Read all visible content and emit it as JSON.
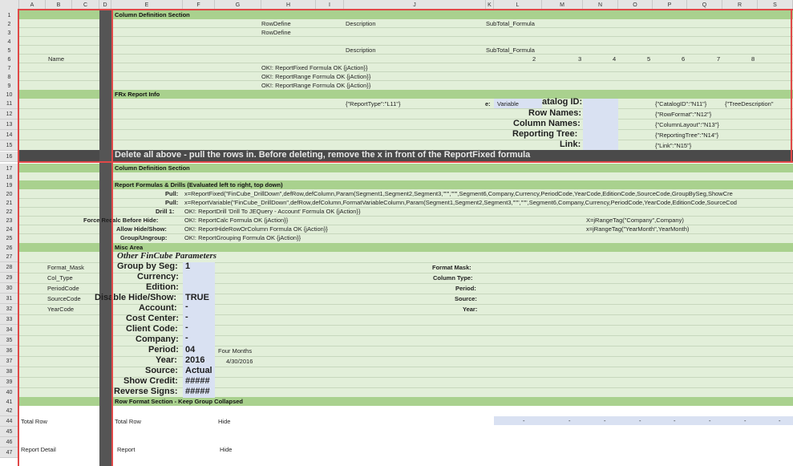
{
  "columns": [
    "A",
    "B",
    "C",
    "D",
    "E",
    "F",
    "G",
    "H",
    "I",
    "J",
    "K",
    "L",
    "M",
    "N",
    "O",
    "P",
    "Q",
    "R",
    "S"
  ],
  "rows": [
    "1",
    "2",
    "3",
    "4",
    "5",
    "6",
    "7",
    "8",
    "9",
    "10",
    "11",
    "12",
    "13",
    "14",
    "15",
    "16",
    "17",
    "18",
    "19",
    "20",
    "21",
    "22",
    "23",
    "24",
    "25",
    "26",
    "27",
    "28",
    "29",
    "30",
    "31",
    "32",
    "33",
    "34",
    "35",
    "36",
    "37",
    "38",
    "39",
    "40",
    "41",
    "42",
    "44",
    "45",
    "46",
    "47"
  ],
  "sections": {
    "col_def_1": "Column Definition Section",
    "frx": "FRx Report Info",
    "delete_note": "Delete all above - pull the rows in. Before deleting, remove the x in front of the ReportFixed formula",
    "col_def_2": "Column Definition Section",
    "formulas": "Report Formulas & Drills (Evaluated left to right, top down)",
    "misc": "Misc Area",
    "other_params": "Other FinCube Parameters",
    "row_format": "Row Format Section - Keep Group Collapsed"
  },
  "top": {
    "r2_h": "RowDefine",
    "r2_j": "Description",
    "r2_l": "SubTotal_Formula",
    "r3_h": "RowDefine",
    "r5_j": "Description",
    "r5_l": "SubTotal_Formula",
    "r6_a": "Name",
    "nums": [
      "2",
      "3",
      "4",
      "5",
      "6",
      "7",
      "8"
    ],
    "r7": "OK!: ReportFixed Formula OK {jAction}}",
    "r8": "OK!: ReportRange Formula OK {jAction}}",
    "r9": "OK!: ReportRange Formula OK {jAction}}"
  },
  "frx": {
    "report_type": "{\"ReportType\":\"L11\"}",
    "e_label": "e:",
    "variable": "Variable",
    "catalog_label": "atalog ID:",
    "row_names": "Row Names:",
    "column_names": "Column Names:",
    "reporting_tree": "Reporting Tree:",
    "link": "Link:",
    "catalog_json": "{\"CatalogID\":\"N11\"}",
    "tree_desc": "{\"TreeDescription\"",
    "row_format": "{\"RowFormat\":\"N12\"}",
    "col_layout": "{\"ColumnLayout\":\"N13\"}",
    "rep_tree": "{\"ReportingTree\":\"N14\"}",
    "link_json": "{\"Link\":\"N15\"}"
  },
  "formulas": {
    "pull_label": "Pull:",
    "pull_1": "x=ReportFixed(\"FinCube_DrillDown\",defRow,defColumn,Param(Segment1,Segment2,Segment3,\"\"\",\"\"\",Segment6,Company,Currency,PeriodCode,YearCode,EditionCode,SourceCode,GroupBySeg,ShowCre",
    "pull_2": "x=ReportVariable(\"FinCube_DrillDown\",defRow,defColumn,FormatVariableColumn,Param(Segment1,Segment2,Segment3,\"\"\",\"\"\",Segment6,Company,Currency,PeriodCode,YearCode,EditionCode,SourceCod",
    "drill_label": "Drill 1:",
    "drill": "OK!: ReportDrill 'Drill To JEQuery - Account' Formula OK {jAction}}",
    "force_label": "Force Recalc Before Hide:",
    "force": "OK!: ReportCalc Formula OK {jAction}}",
    "force_right": "X=jRangeTag(\"Company\",Company)",
    "allow_label": "Allow Hide/Show:",
    "allow": "OK!: ReportHideRowOrColumn Formula OK {jAction}}",
    "allow_right": "x=jRangeTag(\"YearMonth\",YearMonth)",
    "group_label": "Group/Ungroup:",
    "group": "OK!: ReportGrouping Formula OK {jAction}}"
  },
  "params": {
    "left_names": [
      "Format_Mask",
      "Col_Type",
      "PeriodCode",
      "SourceCode",
      "YearCode"
    ],
    "labels": [
      "Group by Seg:",
      "Currency:",
      "Edition:",
      "Disable Hide/Show:",
      "Account:",
      "Cost Center:",
      "Client Code:",
      "Company:",
      "Period:",
      "Year:",
      "Source:",
      "Show Credit:",
      "Reverse Signs:"
    ],
    "values": [
      "1",
      "",
      "",
      "TRUE",
      "-",
      "-",
      "-",
      "-",
      "04",
      "2016",
      "Actual",
      "#####",
      "#####"
    ],
    "period_note": "Four Months",
    "year_note": "4/30/2016",
    "right_labels": [
      "Format Mask:",
      "Column Type:",
      "Period:",
      "Source:",
      "Year:"
    ]
  },
  "rowfmt": {
    "total_a": "Total Row",
    "total_e": "Total Row",
    "hide_1": "Hide",
    "dashes": [
      "-",
      "-",
      "-",
      "-",
      "-",
      "-",
      "-",
      "-",
      "-"
    ],
    "detail_a": "Report Detail",
    "detail_e": "Report",
    "hide_2": "Hide"
  },
  "colors": {
    "light_green": "#e2efd9",
    "dark_green": "#a9d18e",
    "dark_gray": "#4a4a4a",
    "input_blue": "#d9e1f2",
    "red_outline": "#e04848"
  }
}
